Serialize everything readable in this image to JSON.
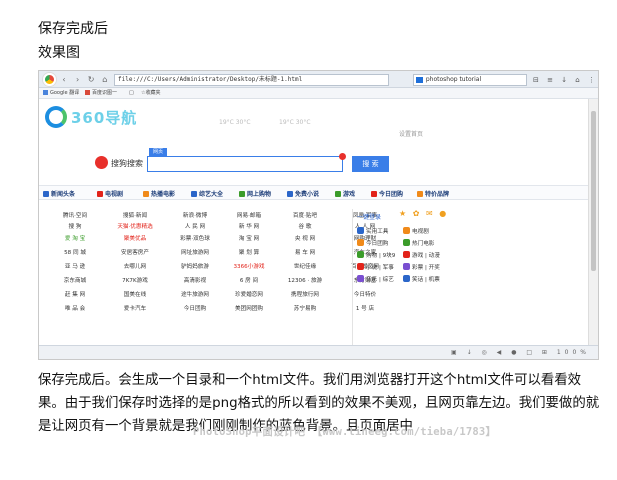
{
  "article": {
    "line1": "保存完成后",
    "line2": "效果图",
    "body": "保存完成后。会生成一个目录和一个html文件。我们用浏览器打开这个html文件可以看看效果。由于我们保存时选择的是png格式的所以看到的效果不美观，且网页靠左边。我们要做的就是让网页有一个背景就是我们刚刚制作的蓝色背景。且页面居中",
    "watermark": "PhotoShop平面设计吧 【www.lineeg.com/tieba/1783】"
  },
  "browser": {
    "nav_back": "‹",
    "nav_forward": "›",
    "nav_reload": "↻",
    "nav_home": "⌂",
    "address": "file:///C:/Users/Administrator/Desktop/未标题-1.html",
    "search_value": "photoshop tutorial",
    "right_icons": "⊟ ≡ ↓ ⌂ ⋮",
    "bookmarks": [
      "Google 翻译",
      "百度识图一",
      "□",
      "☆收藏夹"
    ],
    "status_icons": "▣ ↓ ◎ ◀ ● □ ⊞ 100%"
  },
  "page": {
    "logo_text": "360导航",
    "weather": [
      "19°C  30°C",
      "19°C  30°C"
    ],
    "weather_sub": [
      "",
      "",
      "",
      "设置首页"
    ],
    "search_engine_label": "搜狗搜索",
    "search_tab": "网页",
    "search_button": "搜 索",
    "categories": [
      "新闻头条",
      "电视剧",
      "热播电影",
      "综艺大全",
      "网上购物",
      "免费小说",
      "游戏",
      "今日团购",
      "特价品牌"
    ],
    "grid": [
      [
        "腾讯·空间",
        "搜狐·新闻",
        "新浪·微博",
        "网易·邮箱",
        "百度·贴吧",
        "凤凰·军事"
      ],
      [
        "搜 狗",
        "天猫·优惠精选",
        "人 民 网",
        "新 华 网",
        "谷 歌",
        "人 人 网"
      ],
      [
        "爱 淘 宝",
        "聚美优品",
        "彩票·双色球",
        "淘 宝 网",
        "央 视 网",
        "网购理财"
      ],
      [
        "58 同 城",
        "安居客房产",
        "网址旅游网",
        "聚 划 算",
        "易 车 网",
        "汽车之家"
      ],
      [
        "亚 马 逊",
        "去哪儿网",
        "驴妈妈旅游",
        "3366小游戏",
        "世纪佳缘",
        "百合婚恋网"
      ],
      [
        "京东商城",
        "7K7K游戏",
        "高清影视",
        "6 房 间",
        "12306 · 旅游",
        "东方财富"
      ],
      [
        "赶 集 网",
        "国美在线",
        "途牛旅游网",
        "珍爱婚恋网",
        "携程旅行网",
        "今日特价"
      ],
      [
        "唯 品 会",
        "爱卡汽车",
        "今日团购",
        "美团网团购",
        "苏宁易购",
        "1 号 店"
      ]
    ],
    "right_panel": {
      "header": "一键登录",
      "icons": "★ ✿ ✉ ●",
      "items": [
        [
          "实用工具",
          "电视剧"
        ],
        [
          "今日团购",
          "热门电影"
        ],
        [
          "购物 | 9块9",
          "游戏 | 动漫"
        ],
        [
          "小说 | 军事",
          "彩票 | 开奖"
        ],
        [
          "音乐 | 综艺",
          "笑话 | 机票"
        ]
      ]
    }
  },
  "colors": {
    "accent_blue": "#3a7ee8",
    "logo_blue": "#1c8ee0",
    "red": "#e2231a"
  }
}
